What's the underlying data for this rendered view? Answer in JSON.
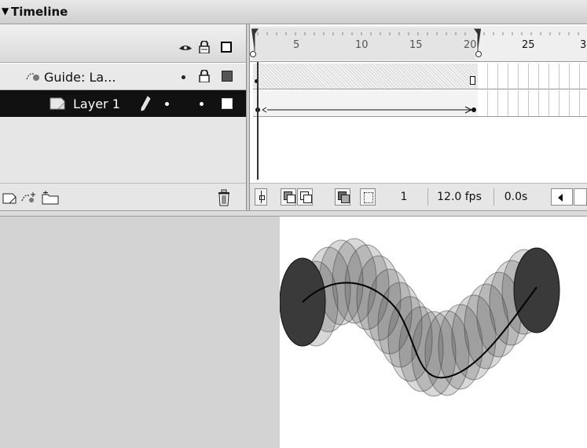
{
  "panel": {
    "title": "Timeline",
    "collapse_icon": "triangle-down-icon"
  },
  "header_icons": [
    "eye-icon",
    "lock-icon",
    "outline-icon"
  ],
  "layers": [
    {
      "name": "Guide: La...",
      "type": "guide",
      "icon": "guide-layer-icon",
      "locked": true,
      "outline_color": "#555555",
      "selected": false
    },
    {
      "name": "Layer 1",
      "type": "normal",
      "icon": "layer-icon",
      "editing": true,
      "outline_color": "#ffffff",
      "selected": true
    }
  ],
  "ruler": {
    "ticks": [
      "5",
      "10",
      "15",
      "20",
      "25",
      "3"
    ]
  },
  "footer": {
    "layer_buttons": [
      "insert-layer-icon",
      "add-motion-guide-icon",
      "insert-layer-folder-icon"
    ],
    "trash_icon": "trash-icon",
    "onion_buttons": [
      "center-frame-icon",
      "onion-skin-icon",
      "onion-skin-outlines-icon",
      "edit-multiple-frames-icon",
      "modify-onion-markers-icon"
    ],
    "current_frame": "1",
    "frame_rate": "12.0 fps",
    "elapsed_time": "0.0s",
    "scroll_left_icon": "scroll-left-icon"
  },
  "colors": {
    "selected_layer_bg": "#111111",
    "stage_bg": "#ffffff",
    "pasteboard_bg": "#d3d3d3",
    "ellipse_fill": "#3a3a3a"
  }
}
